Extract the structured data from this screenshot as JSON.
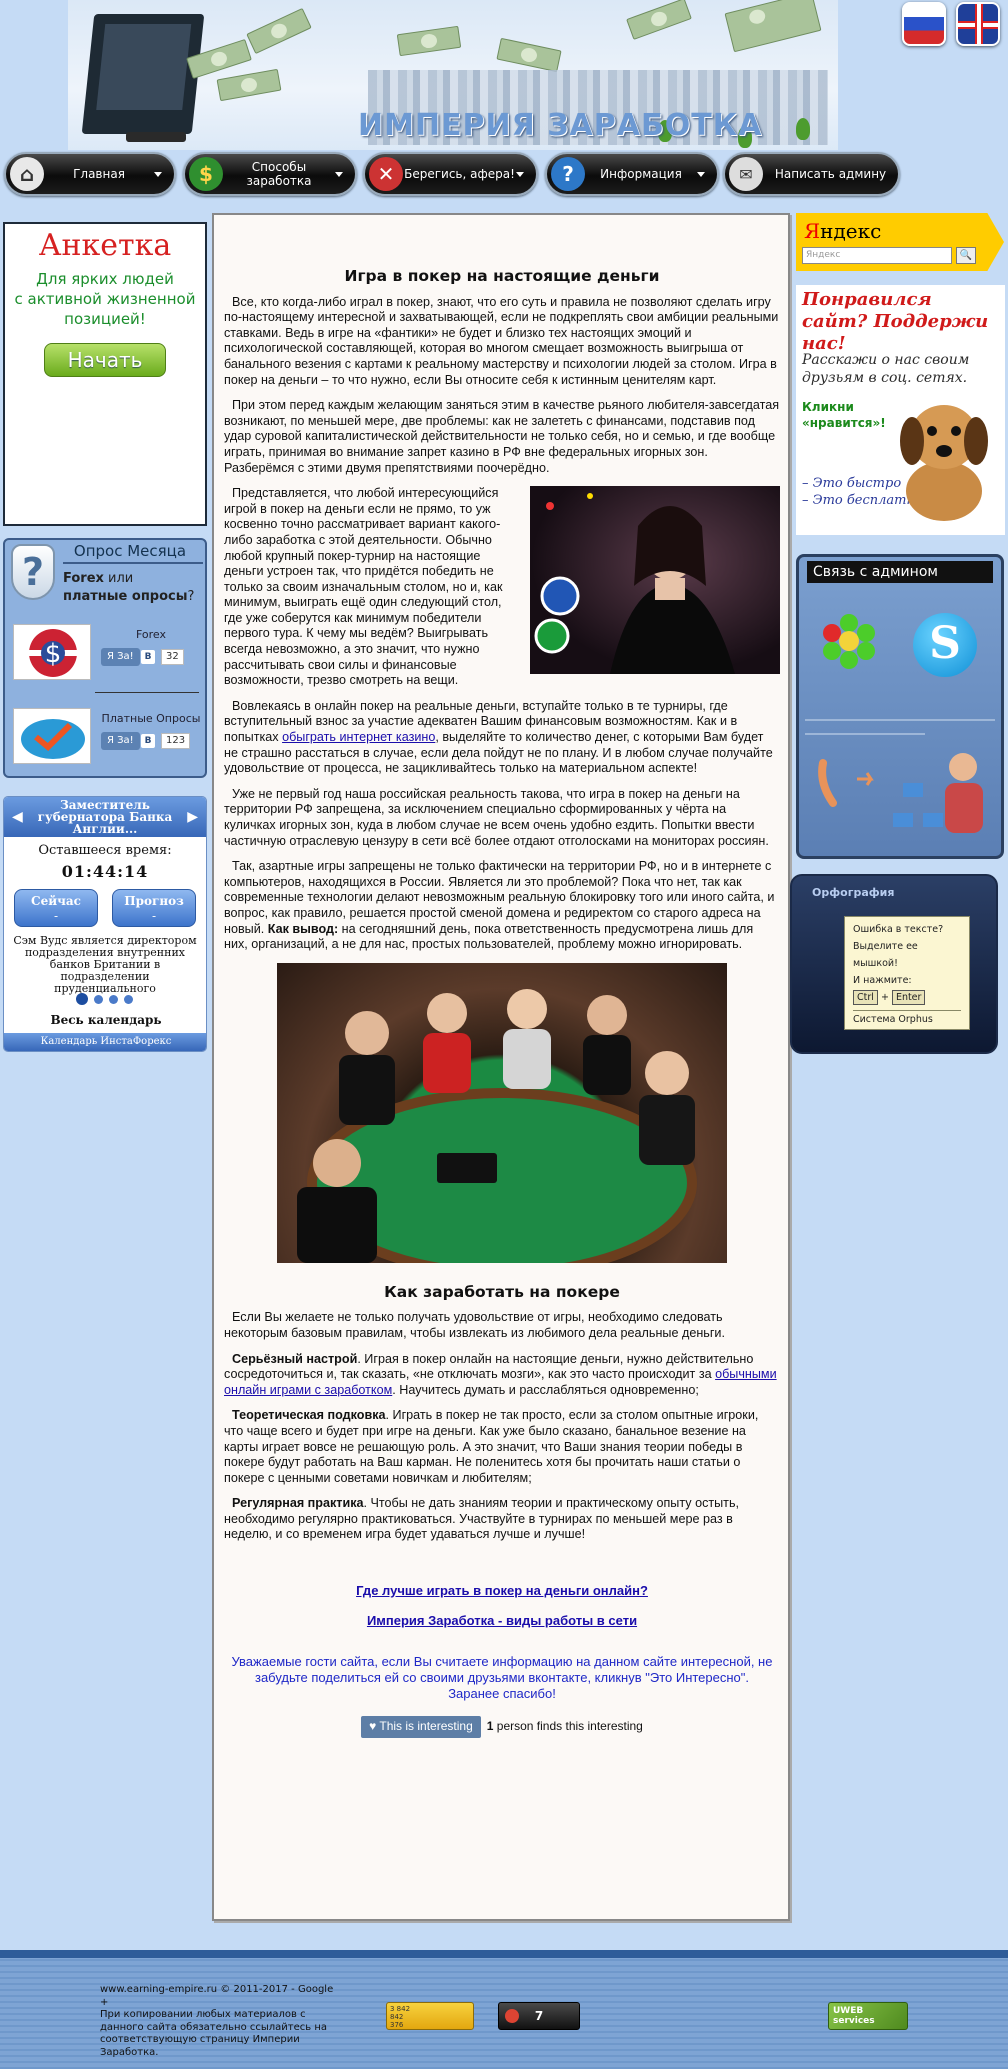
{
  "header": {
    "logo_text": "ИМПЕРИЯ ЗАРАБОТКА",
    "flags": [
      "ru-flag",
      "uk-flag"
    ]
  },
  "nav": [
    {
      "label": "Главная",
      "icon": "home-icon",
      "color": "#e8e8e8"
    },
    {
      "label": "Способы заработка",
      "icon": "dollar-icon",
      "color": "#2f8f2f"
    },
    {
      "label": "Берегись, афера!",
      "icon": "cross-icon",
      "color": "#b22"
    },
    {
      "label": "Информация",
      "icon": "question-icon",
      "color": "#2d78c8"
    },
    {
      "label": "Написать админу",
      "icon": "envelope-icon",
      "color": "#ddd"
    }
  ],
  "anketka": {
    "title": "Анкетка",
    "subtitle_l1": "Для ярких людей",
    "subtitle_l2": "с активной жизненной",
    "subtitle_l3": "позицией!",
    "button": "Начать"
  },
  "poll": {
    "header": "Опрос Месяца",
    "question_bold1": "Forex",
    "question_mid": " или",
    "question_bold2": "платные опросы",
    "question_end": "?",
    "options": [
      {
        "name": "Forex",
        "vote": "Я За!",
        "vk": "В",
        "count": "32"
      },
      {
        "name": "Платные Опросы",
        "vote": "Я За!",
        "vk": "В",
        "count": "123"
      }
    ]
  },
  "calendar": {
    "title": "Заместитель губернатора Банка Англии...",
    "remaining_label": "Оставшееся время:",
    "time": "01:44:14",
    "now_label": "Сейчас",
    "now_value": "-",
    "forecast_label": "Прогноз",
    "forecast_value": "-",
    "text": "Сэм Вудс является директором подразделения внутренних банков Британии в подразделении пруденциального",
    "all_link": "Весь календарь",
    "footer": "Календарь ИнстаФорекс"
  },
  "article": {
    "title": "Игра в покер на настоящие деньги",
    "p1": "Все, кто когда-либо играл в покер, знают, что его суть и правила не позволяют сделать игру по-настоящему интересной и захватывающей, если не подкреплять свои амбиции реальными ставками. Ведь в игре на «фантики» не будет и близко тех настоящих эмоций и психологической составляющей, которая во многом смещает возможность выигрыша от банального везения с картами к реальному мастерству и психологии людей за столом. Игра в покер на деньги – то что нужно, если Вы относите себя к истинным ценителям карт.",
    "p2": "При этом перед каждым желающим заняться этим в качестве рьяного любителя-завсегдатая возникают, по меньшей мере, две проблемы: как не залететь с финансами, подставив под удар суровой капиталистической действительности не только себя, но и семью, и где вообще играть, принимая во внимание запрет казино в РФ вне федеральных игорных зон. Разберёмся с этими двумя препятствиями поочерёдно.",
    "p3": "Представляется, что любой интересующийся игрой в покер на деньги если не прямо, то уж косвенно точно рассматривает вариант какого-либо заработка с этой деятельности. Обычно любой крупный покер-турнир на настоящие деньги устроен так, что придётся победить не только за своим изначальным столом, но и, как минимум, выиграть ещё один следующий стол, где уже соберутся как минимум победители первого тура. К чему мы ведём? Выигрывать всегда невозможно, а это значит, что нужно рассчитывать свои силы и финансовые возможности, трезво смотреть на вещи.",
    "p4a": "Вовлекаясь в онлайн покер на реальные деньги, вступайте только в те турниры, где вступительный взнос за участие адекватен Вашим финансовым возможностям. Как и в попытках ",
    "p4_link": "обыграть интернет казино",
    "p4b": ", выделяйте то количество денег, с которыми Вам будет не страшно расстаться в случае, если дела пойдут не по плану. И в любом случае получайте удовольствие от процесса, не зацикливайтесь только на материальном аспекте!",
    "p5": "Уже не первый год наша российская реальность такова, что игра в покер на деньги на территории РФ запрещена, за исключением специально сформированных у чёрта на куличках игорных зон, куда в любом случае не всем очень удобно ездить. Попытки ввести частичную отраслевую цензуру в сети всё более отдают отголосками на мониторах россиян.",
    "p6a": "Так, азартные игры запрещены не только фактически на территории РФ, но и в интернете с компьютеров, находящихся в России. Является ли это проблемой? Пока что нет, так как современные технологии делают невозможным реальную блокировку того или иного сайта, и вопрос, как правило, решается простой сменой домена и редиректом со старого адреса на новый. ",
    "p6_bold": "Как вывод:",
    "p6b": " на сегодняшний день, пока ответственность предусмотрена лишь для них, организаций, а не для нас, простых пользователей, проблему можно игнорировать.",
    "subtitle": "Как заработать на покере",
    "p7": "Если Вы желаете не только получать удовольствие от игры, необходимо следовать некоторым базовым правилам, чтобы извлекать из любимого дела реальные деньги.",
    "p8_bold": "Серьёзный настрой",
    "p8a": ". Играя в покер онлайн на настоящие деньги, нужно действительно сосредоточиться и, так сказать, «не отключать мозги», как это часто происходит за ",
    "p8_link": "обычными онлайн играми с заработком",
    "p8b": ". Научитесь думать и расслабляться одновременно;",
    "p9_bold": "Теоретическая подковка",
    "p9": "нности. Играть в покер не так просто, если за столом опытные игроки, что чаще всего и будет при игре на деньги. Как уже было сказано, банальное везение на карты играет вовсе не решающую роль. А это значит, что Ваши знания теории победы в покере будут работать на Ваш карман. Не поленитесь хотя бы прочитать наши статьи о покере с ценными советами новичкам и любителям;",
    "p10_bold": "Регулярная практика",
    "p10": ". Чтобы не дать знаниям теории и практическому опыту остыть, необходимо регулярно практиковаться. Участвуйте в турнирах по меньшей мере раз в неделю, и со временем игра будет удаваться лучше и лучше!",
    "link1": "Где лучше играть в покер на деньги онлайн?",
    "link2": "Империя Заработка - виды работы в сети",
    "thanks_l1": "Уважаемые гости сайта, если Вы считаете информацию на данном сайте интересной, не забудьте поделиться ей со своими друзьями вконтакте, кликнув \"Это Интересно\".",
    "thanks_l2": "Заранее спасибо!",
    "interesting_btn": "This is interesting",
    "interesting_count": "1",
    "interesting_text": " person finds this interesting"
  },
  "yandex": {
    "logo_y": "Я",
    "logo_rest": "ндекс",
    "placeholder": "Яндекс",
    "button": "🔍"
  },
  "share": {
    "title": "Понравился сайт? Поддержи нас!",
    "text": "Расскажи о нас своим друзьям в соц. сетях.",
    "click_l1": "Кликни",
    "click_l2": "«нравится»!",
    "list_l1": "– Это быстро",
    "list_l2": "– Это бесплатно"
  },
  "contact": {
    "title": "Связь с админом"
  },
  "orphus": {
    "header": "Орфография",
    "l1": "Ошибка в тексте?",
    "l2": "Выделите ее мышкой!",
    "l3": "И нажмите:",
    "key1": "Ctrl",
    "plus": "+",
    "key2": "Enter",
    "l5": "Система Orphus"
  },
  "footer": {
    "copyright": "www.earning-empire.ru © 2011-2017 - ",
    "google_link": "Google +",
    "notice": "При копировании любых материалов с данного сайта обязательно ссылайтесь на соответствующую страницу Империи Заработка.",
    "counter1": "3 842\n842\n376",
    "counter2": "7",
    "uweb": "UWEB services"
  }
}
